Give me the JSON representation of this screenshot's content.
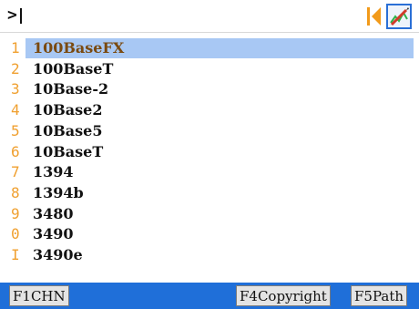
{
  "input": {
    "prompt": ">"
  },
  "list": {
    "items": [
      {
        "key": "1",
        "label": "100BaseFX",
        "selected": true
      },
      {
        "key": "2",
        "label": "100BaseT"
      },
      {
        "key": "3",
        "label": "10Base-2"
      },
      {
        "key": "4",
        "label": "10Base2"
      },
      {
        "key": "5",
        "label": "10Base5"
      },
      {
        "key": "6",
        "label": "10BaseT"
      },
      {
        "key": "7",
        "label": "1394"
      },
      {
        "key": "8",
        "label": "1394b"
      },
      {
        "key": "9",
        "label": "3480"
      },
      {
        "key": "0",
        "label": "3490"
      },
      {
        "key": "I",
        "label": "3490e"
      }
    ]
  },
  "softkeys": {
    "f1": "F1CHN",
    "f4": "F4Copyright",
    "f5": "F5Path"
  },
  "colors": {
    "accent_blue": "#1f6fd9",
    "selection": "#a8c8f4",
    "key_orange": "#f0a030"
  }
}
